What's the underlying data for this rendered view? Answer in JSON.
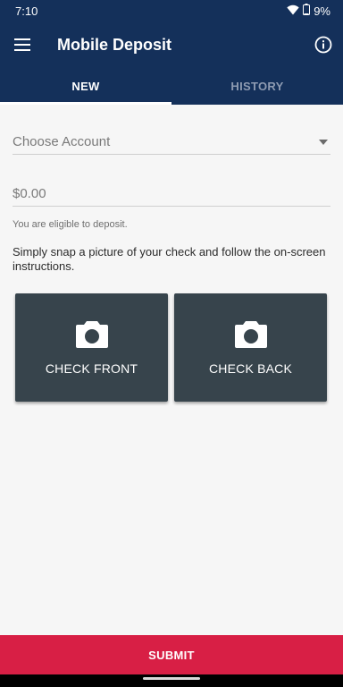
{
  "status_bar": {
    "time": "7:10",
    "battery": "9%",
    "icons": [
      "wifi-icon",
      "battery-icon"
    ]
  },
  "app_bar": {
    "title": "Mobile Deposit",
    "menu_icon": "hamburger-menu-icon",
    "info_icon": "info-icon"
  },
  "tabs": [
    {
      "label": "NEW",
      "selected": true
    },
    {
      "label": "HISTORY",
      "selected": false
    }
  ],
  "form": {
    "account_placeholder": "Choose Account",
    "amount_placeholder": "$0.00",
    "eligibility": "You are eligible to deposit.",
    "instructions": "Simply snap a picture of your check and follow the on-screen instructions."
  },
  "capture": {
    "front_label": "CHECK FRONT",
    "back_label": "CHECK BACK",
    "icon": "camera-icon"
  },
  "submit_label": "SUBMIT",
  "colors": {
    "header": "#14305a",
    "card": "#37444c",
    "submit": "#d81f45",
    "background": "#f6f6f6"
  }
}
